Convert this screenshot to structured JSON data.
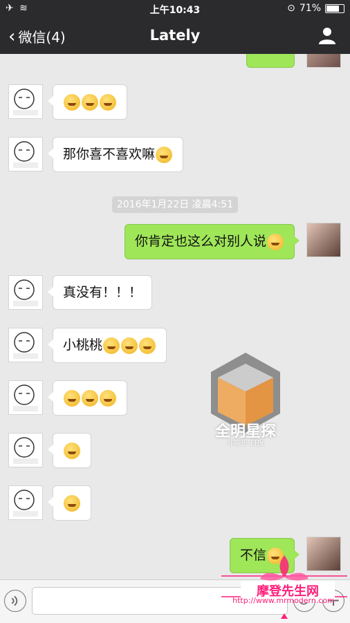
{
  "status_bar": {
    "left_icons": "✈ ≋",
    "time": "上午10:43",
    "battery": "71%"
  },
  "nav": {
    "back_label": "微信(4)",
    "title": "Lately"
  },
  "messages": [
    {
      "side": "right",
      "text": ""
    },
    {
      "side": "left",
      "text": ""
    },
    {
      "side": "left",
      "text": "那你喜不喜欢嘛"
    },
    {
      "side": "right",
      "text": "你肯定也这么对别人说"
    },
    {
      "side": "left",
      "text": "真没有！！！"
    },
    {
      "side": "left",
      "text": "小桃桃"
    },
    {
      "side": "left",
      "text": ""
    },
    {
      "side": "left",
      "text": ""
    },
    {
      "side": "left",
      "text": ""
    },
    {
      "side": "right",
      "text": "不信"
    }
  ],
  "timestamp": "2016年1月22日 凌晨4:51",
  "watermark": {
    "name": "全明星探",
    "sub": "非娱乐·日报"
  },
  "site": {
    "name": "摩登先生网",
    "url": "http://www.mrmodern.com"
  },
  "colors": {
    "nav_bg": "#2b2b2e",
    "chat_bg": "#e9e9e9",
    "right_bubble": "#9fe659",
    "watermark_pink": "#ff1f7a"
  }
}
